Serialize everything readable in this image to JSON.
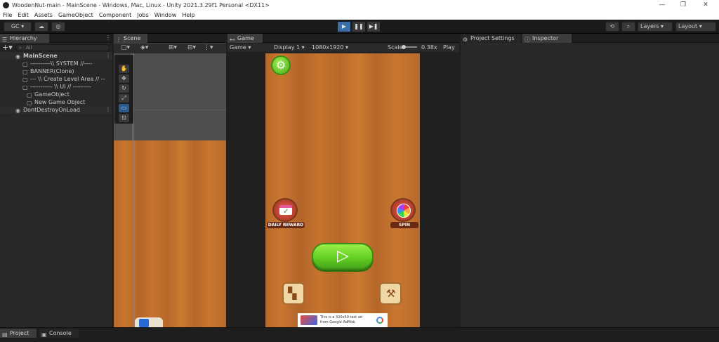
{
  "window": {
    "title": "WoodenNut-main - MainScene - Windows, Mac, Linux - Unity 2021.3.29f1 Personal <DX11>",
    "minimize": "—",
    "maximize": "❐",
    "close": "✕"
  },
  "menu": [
    "File",
    "Edit",
    "Assets",
    "GameObject",
    "Component",
    "Jobs",
    "Window",
    "Help"
  ],
  "toolbar": {
    "account": "GC ▾",
    "layers": "Layers",
    "layout": "Layout",
    "play": "▶",
    "pause": "❚❚",
    "step": "▶❚"
  },
  "hierarchy": {
    "tab": "Hierarchy",
    "search_placeholder": "All",
    "rows": [
      {
        "label": "MainScene",
        "bold": true
      },
      {
        "label": "----------\\\\ SYSTEM //----"
      },
      {
        "label": "BANNER(Clone)"
      },
      {
        "label": "--- \\\\ Create Level Area // --"
      },
      {
        "label": "----------- \\\\ UI // ---------"
      },
      {
        "label": "GameObject"
      },
      {
        "label": "New Game Object"
      },
      {
        "label": "DontDestroyOnLoad"
      }
    ]
  },
  "scene": {
    "tab": "Scene"
  },
  "game": {
    "tab": "Game",
    "mode": "Game",
    "display": "Display 1",
    "resolution": "1080x1920",
    "scale_label": "Scale",
    "scale_value": "0.38x",
    "play_label": "Play",
    "daily_reward": "DAILY REWARD",
    "spin": "SPIN",
    "ad_line1": "This is a 320x50 test ad",
    "ad_line2": "from Google AdMob."
  },
  "right_tabs": {
    "project_settings": "Project Settings",
    "inspector": "Inspector"
  },
  "bottom_tabs": {
    "project": "Project",
    "console": "Console"
  },
  "colors": {
    "wood": "#c3722d",
    "green_button": "#6ad22a",
    "bar": "#1e1e1e",
    "panel": "#282828"
  }
}
